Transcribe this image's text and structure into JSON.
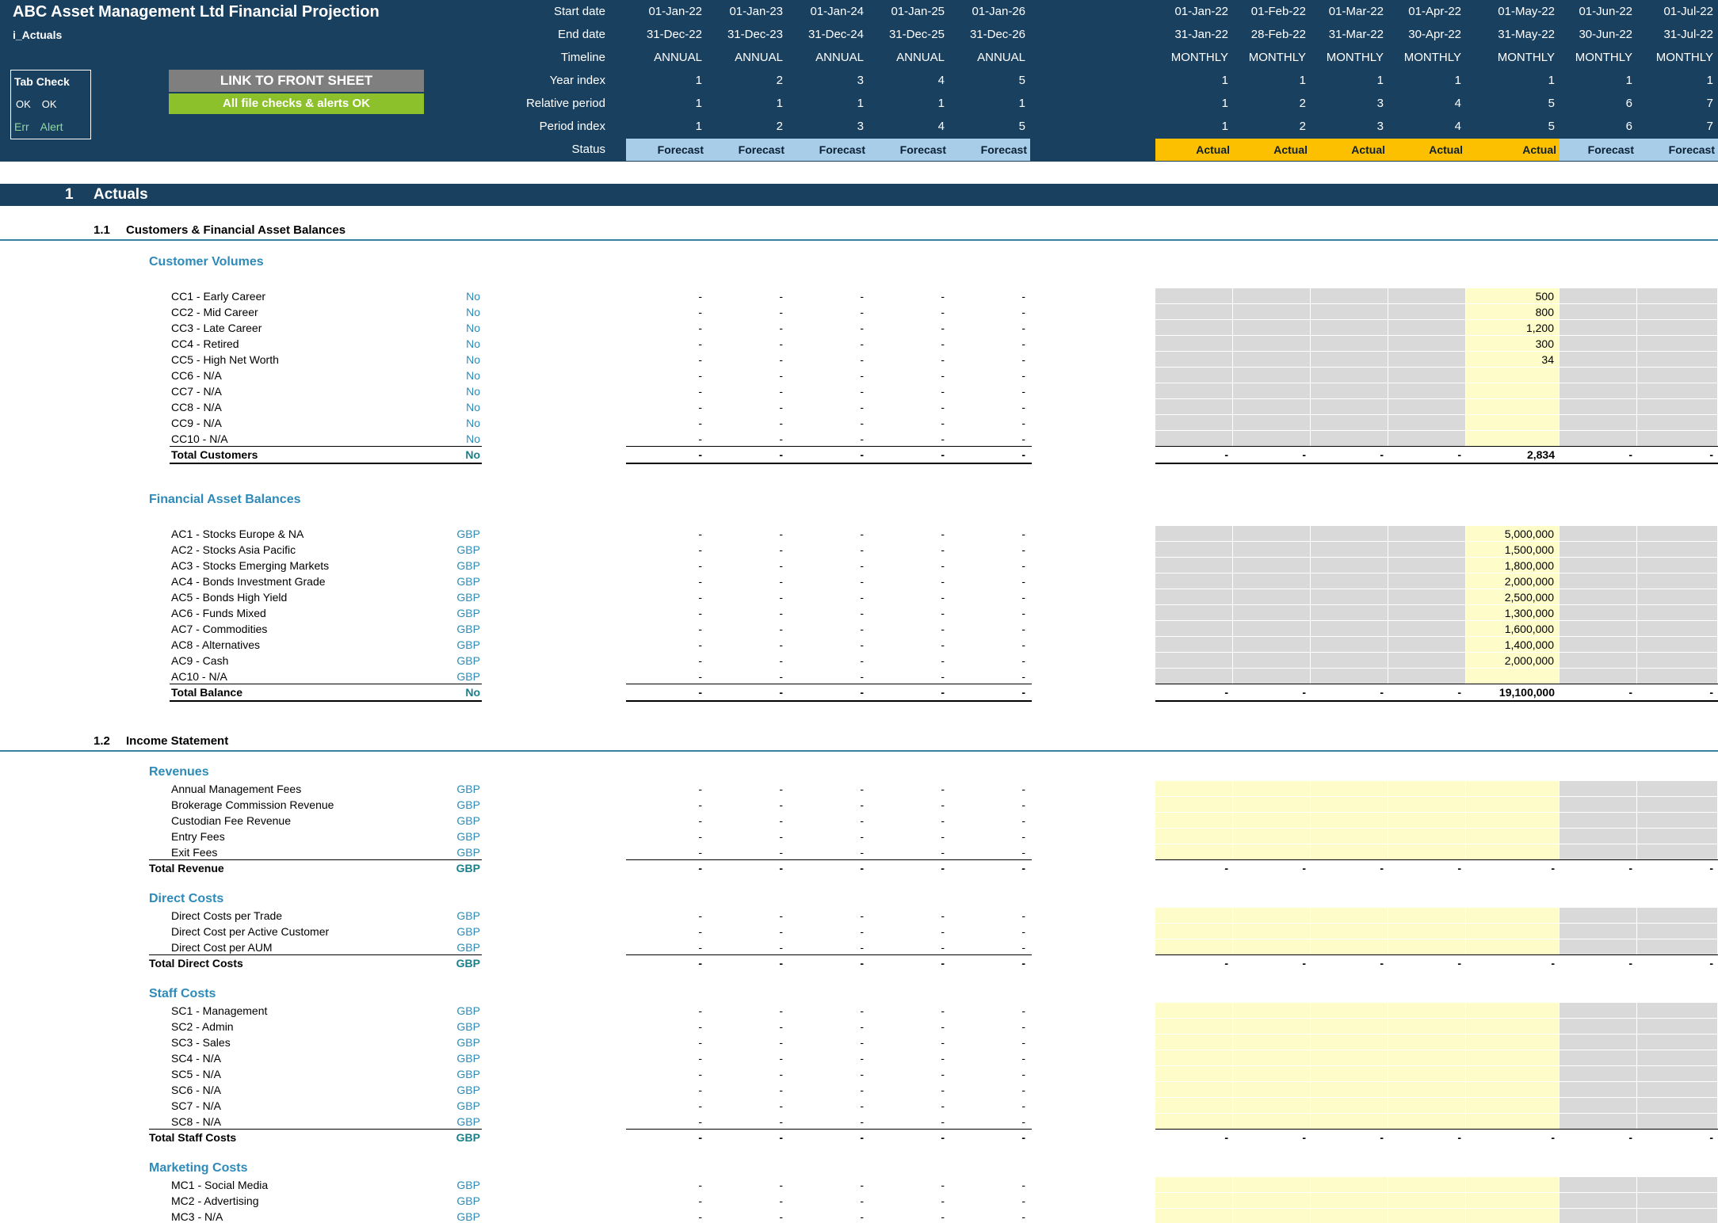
{
  "header": {
    "title": "ABC Asset Management Ltd Financial Projection",
    "sheet_name": "i_Actuals",
    "tab_check": {
      "title": "Tab Check",
      "ok_labels": [
        "OK",
        "OK"
      ],
      "err_labels": [
        "Err",
        "Alert"
      ]
    },
    "link_button": "LINK TO FRONT SHEET",
    "checks_status": "All file checks & alerts OK",
    "row_labels": {
      "start": "Start date",
      "end": "End date",
      "timeline": "Timeline",
      "year_index": "Year index",
      "relative_period": "Relative period",
      "period_index": "Period index",
      "status": "Status"
    },
    "annual_columns": [
      {
        "start": "01-Jan-22",
        "end": "31-Dec-22",
        "timeline": "ANNUAL",
        "year_index": "1",
        "relative_period": "1",
        "period_index": "1",
        "status": "Forecast"
      },
      {
        "start": "01-Jan-23",
        "end": "31-Dec-23",
        "timeline": "ANNUAL",
        "year_index": "2",
        "relative_period": "1",
        "period_index": "2",
        "status": "Forecast"
      },
      {
        "start": "01-Jan-24",
        "end": "31-Dec-24",
        "timeline": "ANNUAL",
        "year_index": "3",
        "relative_period": "1",
        "period_index": "3",
        "status": "Forecast"
      },
      {
        "start": "01-Jan-25",
        "end": "31-Dec-25",
        "timeline": "ANNUAL",
        "year_index": "4",
        "relative_period": "1",
        "period_index": "4",
        "status": "Forecast"
      },
      {
        "start": "01-Jan-26",
        "end": "31-Dec-26",
        "timeline": "ANNUAL",
        "year_index": "5",
        "relative_period": "1",
        "period_index": "5",
        "status": "Forecast"
      }
    ],
    "monthly_columns": [
      {
        "start": "01-Jan-22",
        "end": "31-Jan-22",
        "timeline": "MONTHLY",
        "year_index": "1",
        "relative_period": "1",
        "period_index": "1",
        "status": "Actual"
      },
      {
        "start": "01-Feb-22",
        "end": "28-Feb-22",
        "timeline": "MONTHLY",
        "year_index": "1",
        "relative_period": "2",
        "period_index": "2",
        "status": "Actual"
      },
      {
        "start": "01-Mar-22",
        "end": "31-Mar-22",
        "timeline": "MONTHLY",
        "year_index": "1",
        "relative_period": "3",
        "period_index": "3",
        "status": "Actual"
      },
      {
        "start": "01-Apr-22",
        "end": "30-Apr-22",
        "timeline": "MONTHLY",
        "year_index": "1",
        "relative_period": "4",
        "period_index": "4",
        "status": "Actual"
      },
      {
        "start": "01-May-22",
        "end": "31-May-22",
        "timeline": "MONTHLY",
        "year_index": "1",
        "relative_period": "5",
        "period_index": "5",
        "status": "Actual"
      },
      {
        "start": "01-Jun-22",
        "end": "30-Jun-22",
        "timeline": "MONTHLY",
        "year_index": "1",
        "relative_period": "6",
        "period_index": "6",
        "status": "Forecast"
      },
      {
        "start": "01-Jul-22",
        "end": "31-Jul-22",
        "timeline": "MONTHLY",
        "year_index": "1",
        "relative_period": "7",
        "period_index": "7",
        "status": "Forecast"
      }
    ]
  },
  "section": {
    "number": "1",
    "title": "Actuals"
  },
  "subsections": [
    {
      "number": "1.1",
      "title": "Customers & Financial Asset Balances"
    },
    {
      "number": "1.2",
      "title": "Income Statement"
    }
  ],
  "blocks": [
    {
      "heading": "Customer Volumes",
      "input_cols": [
        0,
        1,
        2,
        3,
        4
      ],
      "rows": [
        {
          "label": "CC1 - Early Career",
          "unit": "No",
          "monthly": [
            "",
            "",
            "",
            "",
            "500",
            "",
            ""
          ]
        },
        {
          "label": "CC2 - Mid Career",
          "unit": "No",
          "monthly": [
            "",
            "",
            "",
            "",
            "800",
            "",
            ""
          ]
        },
        {
          "label": "CC3 - Late Career",
          "unit": "No",
          "monthly": [
            "",
            "",
            "",
            "",
            "1,200",
            "",
            ""
          ]
        },
        {
          "label": "CC4 - Retired",
          "unit": "No",
          "monthly": [
            "",
            "",
            "",
            "",
            "300",
            "",
            ""
          ]
        },
        {
          "label": "CC5 - High Net Worth",
          "unit": "No",
          "monthly": [
            "",
            "",
            "",
            "",
            "34",
            "",
            ""
          ]
        },
        {
          "label": "CC6 - N/A",
          "unit": "No",
          "monthly": [
            "",
            "",
            "",
            "",
            "",
            "",
            ""
          ]
        },
        {
          "label": "CC7 - N/A",
          "unit": "No",
          "monthly": [
            "",
            "",
            "",
            "",
            "",
            "",
            ""
          ]
        },
        {
          "label": "CC8 - N/A",
          "unit": "No",
          "monthly": [
            "",
            "",
            "",
            "",
            "",
            "",
            ""
          ]
        },
        {
          "label": "CC9 - N/A",
          "unit": "No",
          "monthly": [
            "",
            "",
            "",
            "",
            "",
            "",
            ""
          ]
        },
        {
          "label": "CC10 - N/A",
          "unit": "No",
          "monthly": [
            "",
            "",
            "",
            "",
            "",
            "",
            ""
          ]
        }
      ],
      "total": {
        "label": "Total Customers",
        "unit": "No",
        "monthly": [
          "-",
          "-",
          "-",
          "-",
          "2,834",
          "-",
          "-"
        ]
      }
    },
    {
      "heading": "Financial Asset Balances",
      "input_cols": [
        0,
        1,
        2,
        3,
        4
      ],
      "rows": [
        {
          "label": "AC1 - Stocks Europe & NA",
          "unit": "GBP",
          "monthly": [
            "",
            "",
            "",
            "",
            "5,000,000",
            "",
            ""
          ]
        },
        {
          "label": "AC2 - Stocks Asia Pacific",
          "unit": "GBP",
          "monthly": [
            "",
            "",
            "",
            "",
            "1,500,000",
            "",
            ""
          ]
        },
        {
          "label": "AC3 - Stocks Emerging Markets",
          "unit": "GBP",
          "monthly": [
            "",
            "",
            "",
            "",
            "1,800,000",
            "",
            ""
          ]
        },
        {
          "label": "AC4 - Bonds Investment Grade",
          "unit": "GBP",
          "monthly": [
            "",
            "",
            "",
            "",
            "2,000,000",
            "",
            ""
          ]
        },
        {
          "label": "AC5 - Bonds High Yield",
          "unit": "GBP",
          "monthly": [
            "",
            "",
            "",
            "",
            "2,500,000",
            "",
            ""
          ]
        },
        {
          "label": "AC6 - Funds Mixed",
          "unit": "GBP",
          "monthly": [
            "",
            "",
            "",
            "",
            "1,300,000",
            "",
            ""
          ]
        },
        {
          "label": "AC7 - Commodities",
          "unit": "GBP",
          "monthly": [
            "",
            "",
            "",
            "",
            "1,600,000",
            "",
            ""
          ]
        },
        {
          "label": "AC8 - Alternatives",
          "unit": "GBP",
          "monthly": [
            "",
            "",
            "",
            "",
            "1,400,000",
            "",
            ""
          ]
        },
        {
          "label": "AC9 - Cash",
          "unit": "GBP",
          "monthly": [
            "",
            "",
            "",
            "",
            "2,000,000",
            "",
            ""
          ]
        },
        {
          "label": "AC10 - N/A",
          "unit": "GBP",
          "monthly": [
            "",
            "",
            "",
            "",
            "",
            "",
            ""
          ]
        }
      ],
      "total": {
        "label": "Total Balance",
        "unit": "No",
        "monthly": [
          "-",
          "-",
          "-",
          "-",
          "19,100,000",
          "-",
          "-"
        ]
      }
    },
    {
      "heading": "Revenues",
      "rows": [
        {
          "label": "Annual Management Fees",
          "unit": "GBP"
        },
        {
          "label": "Brokerage Commission Revenue",
          "unit": "GBP"
        },
        {
          "label": "Custodian Fee Revenue",
          "unit": "GBP"
        },
        {
          "label": "Entry Fees",
          "unit": "GBP"
        },
        {
          "label": "Exit Fees",
          "unit": "GBP"
        }
      ],
      "total": {
        "label": "Total Revenue",
        "unit": "GBP",
        "monthly": [
          "-",
          "-",
          "-",
          "-",
          "-",
          "-",
          "-"
        ]
      }
    },
    {
      "heading": "Direct Costs",
      "rows": [
        {
          "label": "Direct Costs per Trade",
          "unit": "GBP"
        },
        {
          "label": "Direct Cost per Active Customer",
          "unit": "GBP"
        },
        {
          "label": "Direct Cost per AUM",
          "unit": "GBP"
        }
      ],
      "total": {
        "label": "Total Direct Costs",
        "unit": "GBP",
        "monthly": [
          "-",
          "-",
          "-",
          "-",
          "-",
          "-",
          "-"
        ]
      }
    },
    {
      "heading": "Staff Costs",
      "rows": [
        {
          "label": "SC1 - Management",
          "unit": "GBP"
        },
        {
          "label": "SC2 - Admin",
          "unit": "GBP"
        },
        {
          "label": "SC3 - Sales",
          "unit": "GBP"
        },
        {
          "label": "SC4 - N/A",
          "unit": "GBP"
        },
        {
          "label": "SC5 - N/A",
          "unit": "GBP"
        },
        {
          "label": "SC6 - N/A",
          "unit": "GBP"
        },
        {
          "label": "SC7 - N/A",
          "unit": "GBP"
        },
        {
          "label": "SC8 - N/A",
          "unit": "GBP"
        }
      ],
      "total": {
        "label": "Total Staff Costs",
        "unit": "GBP",
        "monthly": [
          "-",
          "-",
          "-",
          "-",
          "-",
          "-",
          "-"
        ]
      }
    },
    {
      "heading": "Marketing Costs",
      "rows": [
        {
          "label": "MC1 - Social Media",
          "unit": "GBP"
        },
        {
          "label": "MC2 - Advertising",
          "unit": "GBP"
        },
        {
          "label": "MC3 - N/A",
          "unit": "GBP"
        }
      ]
    }
  ],
  "annual_placeholder": "-",
  "colors": {
    "header_bg": "#1a4060",
    "forecast": "#a7cde9",
    "actual": "#fcc000",
    "input_yellow": "#fefdc9",
    "locked_gray": "#d9d9d9",
    "link_button": "#7f7f7f",
    "checks_ok": "#8dc12b",
    "accent_blue": "#2e8ab8"
  }
}
